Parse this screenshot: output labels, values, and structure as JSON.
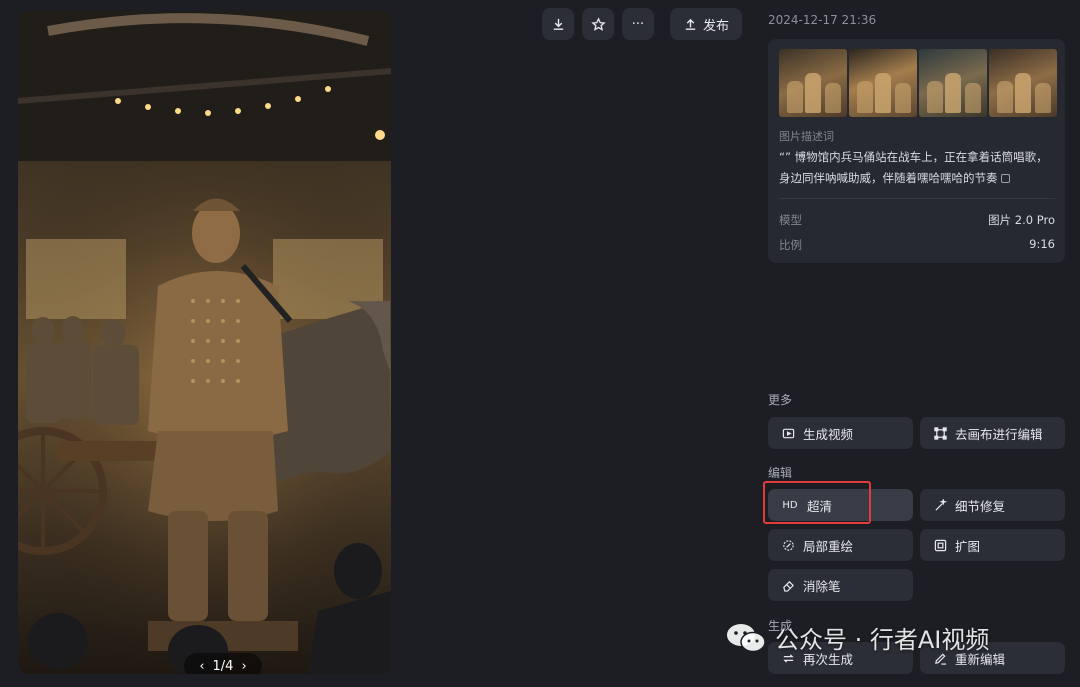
{
  "toolbar": {
    "download_icon": "download-icon",
    "star_icon": "star-icon",
    "more_label": "···",
    "publish_label": "发布"
  },
  "image": {
    "pager_current": "1/4",
    "prev_icon": "chevron-left-icon",
    "next_icon": "chevron-right-icon"
  },
  "details": {
    "timestamp": "2024-12-17 21:36",
    "prompt_label": "图片描述词",
    "prompt_text": "“” 博物馆内兵马俑站在战车上，正在拿着话筒唱歌，身边同伴呐喊助威，伴随着嘿哈嘿哈的节奏",
    "model_label": "模型",
    "model_value": "图片 2.0 Pro",
    "ratio_label": "比例",
    "ratio_value": "9:16"
  },
  "more_section": {
    "title": "更多",
    "generate_video": "生成视频",
    "canvas_edit": "去画布进行编辑"
  },
  "edit_section": {
    "title": "编辑",
    "hd_icon_text": "HD",
    "hd": "超清",
    "detail_repair": "细节修复",
    "partial_redraw": "局部重绘",
    "expand": "扩图",
    "eraser": "消除笔"
  },
  "generate_section": {
    "title": "生成",
    "regenerate": "再次生成",
    "reedit": "重新编辑"
  },
  "watermark": {
    "text": "公众号 · 行者AI视频"
  },
  "colors": {
    "background": "#1c1e24",
    "button": "#2b2e36",
    "highlight": "#e23b3b"
  }
}
